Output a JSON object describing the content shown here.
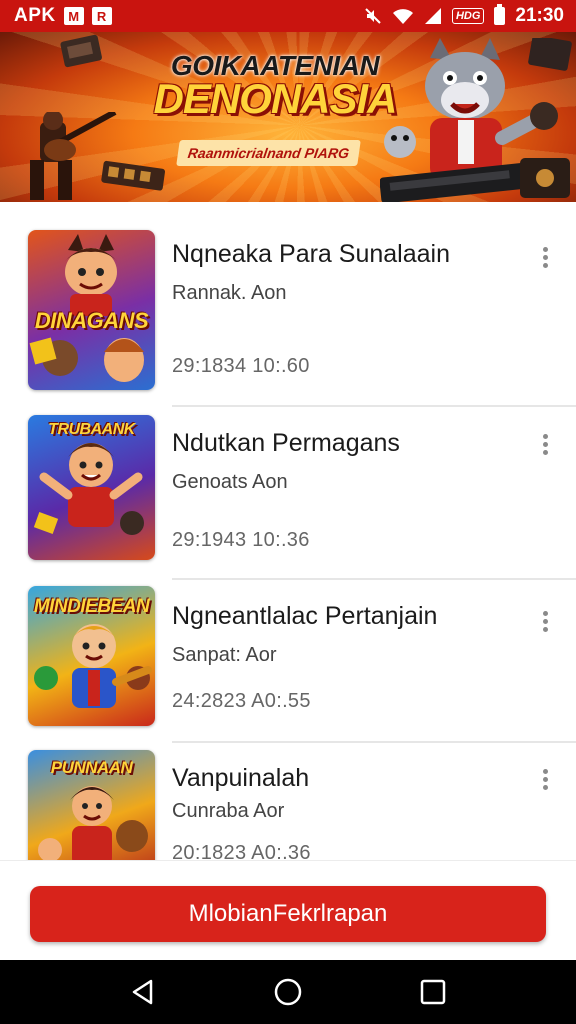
{
  "status_bar": {
    "carrier_label": "APK",
    "mini_icons": [
      "M",
      "R"
    ],
    "network_badge": "HDG",
    "time": "21:30"
  },
  "banner": {
    "title_line1": "GOIKAATENIAN",
    "title_line2": "DENONASIA",
    "subtitle": "Raanmicrialnand PIARG"
  },
  "list": {
    "items": [
      {
        "title": "Nqneaka Para Sunalaain",
        "subtitle": "Rannak. Aon",
        "meta": "29:1834  10:.60",
        "thumb_label": "DINAGANS",
        "thumb_colors": [
          "#e2551a",
          "#7a2fa5",
          "#2b6fd1"
        ]
      },
      {
        "title": "Ndutkan Permagans",
        "subtitle": "Genoats Aon",
        "meta": "29:1943  10:.36",
        "thumb_label": "TRUBAANK",
        "thumb_colors": [
          "#2a7be0",
          "#5a2aa8",
          "#d74a1a"
        ]
      },
      {
        "title": "Ngneantlalac Pertanjain",
        "subtitle": "Sanpat: Aor",
        "meta": "24:2823  A0:.55",
        "thumb_label": "MINDIEBEAN",
        "thumb_colors": [
          "#35a6e0",
          "#f2b316",
          "#c9281a"
        ]
      },
      {
        "title": "Vanpuinalah",
        "subtitle": "Cunraba Aor",
        "meta": "20:1823  A0:.36",
        "thumb_label": "PUNNAAN",
        "thumb_colors": [
          "#3a8fe0",
          "#f0a81a",
          "#b3261a"
        ]
      }
    ]
  },
  "primary_action": {
    "label": "MlobianFekrlrapan"
  },
  "theme": {
    "accent": "#d8231b",
    "status_bar": "#c9140f"
  }
}
